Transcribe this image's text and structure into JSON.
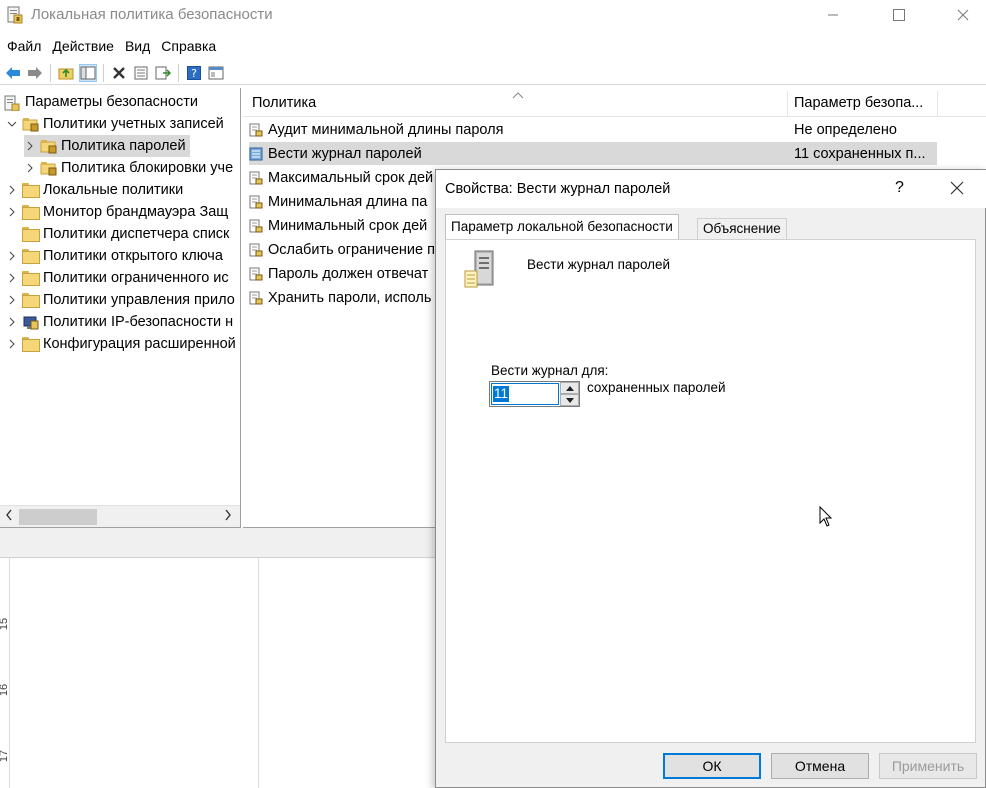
{
  "window": {
    "title": "Локальная политика безопасности",
    "icon": "security-policy-icon"
  },
  "menu": [
    "Файл",
    "Действие",
    "Вид",
    "Справка"
  ],
  "toolbar": {
    "buttons": [
      "back-arrow-icon",
      "forward-arrow-icon",
      "up-folder-icon",
      "show-hide-tree-icon",
      "delete-icon",
      "properties-icon",
      "export-list-icon",
      "help-icon",
      "console-icon"
    ]
  },
  "tree": {
    "root": "Параметры безопасности",
    "items": [
      {
        "label": "Политики учетных записей",
        "expanded": true
      },
      {
        "label": "Политика паролей",
        "selected": true
      },
      {
        "label": "Политика блокировки уче"
      },
      {
        "label": "Локальные политики"
      },
      {
        "label": "Монитор брандмауэра Защ"
      },
      {
        "label": "Политики диспетчера списк"
      },
      {
        "label": "Политики открытого ключа"
      },
      {
        "label": "Политики ограниченного ис"
      },
      {
        "label": "Политики управления прило"
      },
      {
        "label": "Политики IP-безопасности н"
      },
      {
        "label": "Конфигурация расширенной"
      }
    ]
  },
  "list": {
    "columns": [
      "Политика",
      "Параметр безопа..."
    ],
    "rows": [
      {
        "policy": "Аудит минимальной длины пароля",
        "value": "Не определено"
      },
      {
        "policy": "Вести журнал паролей",
        "value": "11 сохраненных п..."
      },
      {
        "policy": "Максимальный срок дей",
        "value": ""
      },
      {
        "policy": "Минимальная длина па",
        "value": ""
      },
      {
        "policy": "Минимальный срок дей",
        "value": ""
      },
      {
        "policy": "Ослабить ограничение п",
        "value": ""
      },
      {
        "policy": "Пароль должен отвечат",
        "value": ""
      },
      {
        "policy": "Хранить пароли, исполь",
        "value": ""
      }
    ]
  },
  "ruler": [
    "15",
    "16",
    "17"
  ],
  "dialog": {
    "title": "Свойства: Вести журнал паролей",
    "help": "?",
    "tabs": [
      "Параметр локальной безопасности",
      "Объяснение"
    ],
    "policy_name": "Вести журнал паролей",
    "retain_label": "Вести журнал для:",
    "retain_value": "11",
    "retain_units": "сохраненных паролей",
    "ok": "ОК",
    "cancel": "Отмена",
    "apply": "Применить"
  }
}
